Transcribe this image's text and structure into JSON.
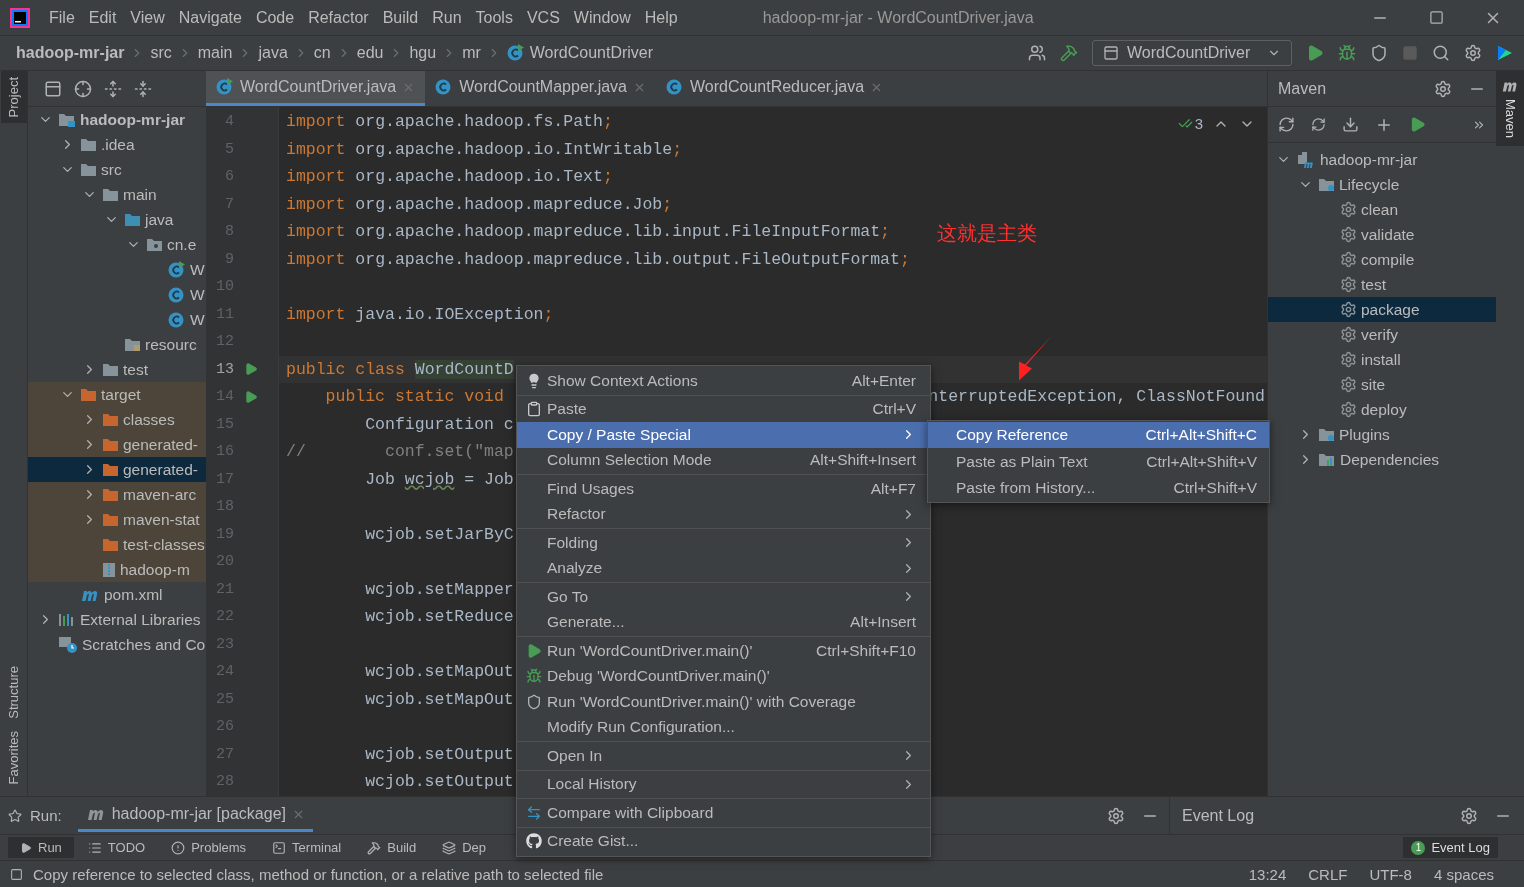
{
  "window": {
    "title": "hadoop-mr-jar - WordCountDriver.java"
  },
  "menu_bar": [
    "File",
    "Edit",
    "View",
    "Navigate",
    "Code",
    "Refactor",
    "Build",
    "Run",
    "Tools",
    "VCS",
    "Window",
    "Help"
  ],
  "breadcrumbs": [
    {
      "label": "hadoop-mr-jar",
      "kind": "project"
    },
    {
      "label": "src",
      "kind": "folder"
    },
    {
      "label": "main",
      "kind": "folder"
    },
    {
      "label": "java",
      "kind": "folder"
    },
    {
      "label": "cn",
      "kind": "folder"
    },
    {
      "label": "edu",
      "kind": "folder"
    },
    {
      "label": "hgu",
      "kind": "folder"
    },
    {
      "label": "mr",
      "kind": "folder"
    },
    {
      "label": "WordCountDriver",
      "kind": "class"
    }
  ],
  "run_config": {
    "label": "WordCountDriver"
  },
  "left_stripe": [
    {
      "label": "Project",
      "selected": true
    },
    {
      "label": "Structure",
      "selected": false
    },
    {
      "label": "Favorites",
      "selected": false
    }
  ],
  "project_tree": [
    {
      "label": "hadoop-mr-jar",
      "kind": "module",
      "expanded": true,
      "selected": false,
      "children": [
        {
          "label": ".idea",
          "kind": "folder",
          "expanded": false,
          "selected": false
        },
        {
          "label": "src",
          "kind": "folder",
          "expanded": true,
          "selected": false,
          "children": [
            {
              "label": "main",
              "kind": "folder",
              "expanded": true,
              "selected": false,
              "children": [
                {
                  "label": "java",
                  "kind": "source",
                  "expanded": true,
                  "selected": false,
                  "children": [
                    {
                      "label": "cn.e",
                      "kind": "package",
                      "expanded": true,
                      "selected": false,
                      "children": [
                        {
                          "label": "W",
                          "kind": "runnable",
                          "selected": false
                        },
                        {
                          "label": "W",
                          "kind": "class",
                          "selected": false
                        },
                        {
                          "label": "W",
                          "kind": "class",
                          "selected": false
                        }
                      ]
                    }
                  ]
                },
                {
                  "label": "resourc",
                  "kind": "resources",
                  "selected": false
                }
              ]
            },
            {
              "label": "test",
              "kind": "folder",
              "expanded": false,
              "selected": false
            }
          ]
        },
        {
          "label": "target",
          "kind": "excluded",
          "expanded": true,
          "selected": false,
          "excluded": true,
          "children": [
            {
              "label": "classes",
              "kind": "excluded",
              "expanded": false,
              "selected": false
            },
            {
              "label": "generated-",
              "kind": "excluded",
              "expanded": false,
              "selected": false
            },
            {
              "label": "generated-",
              "kind": "excluded",
              "expanded": false,
              "selected": true
            },
            {
              "label": "maven-arc",
              "kind": "excluded",
              "expanded": false,
              "selected": false
            },
            {
              "label": "maven-stat",
              "kind": "excluded",
              "expanded": false,
              "selected": false
            },
            {
              "label": "test-classes",
              "kind": "excluded",
              "selected": false
            },
            {
              "label": "hadoop-m",
              "kind": "jar",
              "selected": false
            }
          ]
        },
        {
          "label": "pom.xml",
          "kind": "maven",
          "selected": false
        }
      ]
    },
    {
      "label": "External Libraries",
      "kind": "libraries",
      "expanded": false,
      "selected": false
    },
    {
      "label": "Scratches and Co",
      "kind": "scratches",
      "selected": false
    }
  ],
  "editor_tabs": [
    {
      "label": "WordCountDriver.java",
      "selected": true,
      "runnable": true
    },
    {
      "label": "WordCountMapper.java",
      "selected": false,
      "runnable": false
    },
    {
      "label": "WordCountReducer.java",
      "selected": false,
      "runnable": false
    }
  ],
  "inspection": {
    "count": "3"
  },
  "code_lines": [
    {
      "number": "4",
      "current": false,
      "run": false,
      "segments": [
        {
          "kind": "keyword",
          "text": "import"
        },
        {
          "kind": "plain",
          "text": " org.apache.hadoop.fs.Path"
        },
        {
          "kind": "punct",
          "text": ";"
        }
      ]
    },
    {
      "number": "5",
      "current": false,
      "run": false,
      "segments": [
        {
          "kind": "keyword",
          "text": "import"
        },
        {
          "kind": "plain",
          "text": " org.apache.hadoop.io.IntWritable"
        },
        {
          "kind": "punct",
          "text": ";"
        }
      ]
    },
    {
      "number": "6",
      "current": false,
      "run": false,
      "segments": [
        {
          "kind": "keyword",
          "text": "import"
        },
        {
          "kind": "plain",
          "text": " org.apache.hadoop.io.Text"
        },
        {
          "kind": "punct",
          "text": ";"
        }
      ]
    },
    {
      "number": "7",
      "current": false,
      "run": false,
      "segments": [
        {
          "kind": "keyword",
          "text": "import"
        },
        {
          "kind": "plain",
          "text": " org.apache.hadoop.mapreduce.Job"
        },
        {
          "kind": "punct",
          "text": ";"
        }
      ]
    },
    {
      "number": "8",
      "current": false,
      "run": false,
      "segments": [
        {
          "kind": "keyword",
          "text": "import"
        },
        {
          "kind": "plain",
          "text": " org.apache.hadoop.mapreduce.lib.input.FileInputFormat"
        },
        {
          "kind": "punct",
          "text": ";"
        }
      ]
    },
    {
      "number": "9",
      "current": false,
      "run": false,
      "segments": [
        {
          "kind": "keyword",
          "text": "import"
        },
        {
          "kind": "plain",
          "text": " org.apache.hadoop.mapreduce.lib.output.FileOutputFormat"
        },
        {
          "kind": "punct",
          "text": ";"
        }
      ]
    },
    {
      "number": "10",
      "current": false,
      "run": false
    },
    {
      "number": "11",
      "current": false,
      "run": false,
      "segments": [
        {
          "kind": "keyword",
          "text": "import"
        },
        {
          "kind": "plain",
          "text": " java.io.IOException"
        },
        {
          "kind": "punct",
          "text": ";"
        }
      ]
    },
    {
      "number": "12",
      "current": false,
      "run": false
    },
    {
      "number": "13",
      "current": true,
      "run": true,
      "segments": [
        {
          "kind": "keyword",
          "text": "public class "
        },
        {
          "kind": "highlight",
          "text": "WordCountD"
        }
      ]
    },
    {
      "number": "14",
      "current": false,
      "run": true,
      "segments": [
        {
          "kind": "keyword",
          "text": "    public static void"
        }
      ],
      "tail": "nterruptedException, ClassNotFound"
    },
    {
      "number": "15",
      "current": false,
      "run": false,
      "segments": [
        {
          "kind": "plain",
          "text": "        Configuration c"
        }
      ]
    },
    {
      "number": "16",
      "current": false,
      "run": false,
      "segments": [
        {
          "kind": "comment",
          "text": "//        conf.set(\"map"
        }
      ]
    },
    {
      "number": "17",
      "current": false,
      "run": false,
      "segments": [
        {
          "kind": "plain",
          "text": "        Job "
        },
        {
          "kind": "warn",
          "text": "wcjob"
        },
        {
          "kind": "plain",
          "text": " = Job"
        }
      ]
    },
    {
      "number": "18",
      "current": false,
      "run": false
    },
    {
      "number": "19",
      "current": false,
      "run": false,
      "segments": [
        {
          "kind": "plain",
          "text": "        wcjob.setJarByC"
        }
      ]
    },
    {
      "number": "20",
      "current": false,
      "run": false
    },
    {
      "number": "21",
      "current": false,
      "run": false,
      "segments": [
        {
          "kind": "plain",
          "text": "        wcjob.setMapper"
        }
      ]
    },
    {
      "number": "22",
      "current": false,
      "run": false,
      "segments": [
        {
          "kind": "plain",
          "text": "        wcjob.setReduce"
        }
      ]
    },
    {
      "number": "23",
      "current": false,
      "run": false
    },
    {
      "number": "24",
      "current": false,
      "run": false,
      "segments": [
        {
          "kind": "plain",
          "text": "        wcjob.setMapOut"
        }
      ]
    },
    {
      "number": "25",
      "current": false,
      "run": false,
      "segments": [
        {
          "kind": "plain",
          "text": "        wcjob.setMapOut"
        }
      ]
    },
    {
      "number": "26",
      "current": false,
      "run": false
    },
    {
      "number": "27",
      "current": false,
      "run": false,
      "segments": [
        {
          "kind": "plain",
          "text": "        wcjob.setOutput"
        }
      ]
    },
    {
      "number": "28",
      "current": false,
      "run": false,
      "segments": [
        {
          "kind": "plain",
          "text": "        wcjob.setOutput"
        }
      ]
    }
  ],
  "annotation": {
    "text": "这就是主类"
  },
  "context_menu": [
    [
      {
        "label": "Show Context Actions",
        "shortcut": "Alt+Enter",
        "kind": "bulb",
        "selected": false
      }
    ],
    [
      {
        "label": "Paste",
        "shortcut": "Ctrl+V",
        "kind": "paste",
        "selected": false
      },
      {
        "label": "Copy / Paste Special",
        "submenu": true,
        "selected": true
      },
      {
        "label": "Column Selection Mode",
        "shortcut": "Alt+Shift+Insert",
        "selected": false
      }
    ],
    [
      {
        "label": "Find Usages",
        "shortcut": "Alt+F7",
        "selected": false
      },
      {
        "label": "Refactor",
        "submenu": true,
        "selected": false
      }
    ],
    [
      {
        "label": "Folding",
        "submenu": true,
        "selected": false
      },
      {
        "label": "Analyze",
        "submenu": true,
        "selected": false
      }
    ],
    [
      {
        "label": "Go To",
        "submenu": true,
        "selected": false
      },
      {
        "label": "Generate...",
        "shortcut": "Alt+Insert",
        "selected": false
      }
    ],
    [
      {
        "label": "Run 'WordCountDriver.main()'",
        "shortcut": "Ctrl+Shift+F10",
        "kind": "run",
        "selected": false
      },
      {
        "label": "Debug 'WordCountDriver.main()'",
        "kind": "debug",
        "selected": false
      },
      {
        "label": "Run 'WordCountDriver.main()' with Coverage",
        "kind": "coverage",
        "selected": false
      },
      {
        "label": "Modify Run Configuration...",
        "selected": false
      }
    ],
    [
      {
        "label": "Open In",
        "submenu": true,
        "selected": false
      }
    ],
    [
      {
        "label": "Local History",
        "submenu": true,
        "selected": false
      }
    ],
    [
      {
        "label": "Compare with Clipboard",
        "kind": "compare",
        "selected": false
      }
    ],
    [
      {
        "label": "Create Gist...",
        "kind": "github",
        "selected": false
      }
    ]
  ],
  "submenu": [
    {
      "label": "Copy Reference",
      "shortcut": "Ctrl+Alt+Shift+C",
      "selected": true
    },
    {
      "label": "Paste as Plain Text",
      "shortcut": "Ctrl+Alt+Shift+V",
      "selected": false
    },
    {
      "label": "Paste from History...",
      "shortcut": "Ctrl+Shift+V",
      "selected": false
    }
  ],
  "maven": {
    "title": "Maven",
    "tree": [
      {
        "label": "hadoop-mr-jar",
        "kind": "maven-module",
        "expanded": true,
        "selected": false,
        "children": [
          {
            "label": "Lifecycle",
            "kind": "lifecycle",
            "expanded": true,
            "selected": false,
            "children": [
              {
                "label": "clean",
                "kind": "goal",
                "selected": false
              },
              {
                "label": "validate",
                "kind": "goal",
                "selected": false
              },
              {
                "label": "compile",
                "kind": "goal",
                "selected": false
              },
              {
                "label": "test",
                "kind": "goal",
                "selected": false
              },
              {
                "label": "package",
                "kind": "goal",
                "selected": true
              },
              {
                "label": "verify",
                "kind": "goal",
                "selected": false
              },
              {
                "label": "install",
                "kind": "goal",
                "selected": false
              },
              {
                "label": "site",
                "kind": "goal",
                "selected": false
              },
              {
                "label": "deploy",
                "kind": "goal",
                "selected": false
              }
            ]
          },
          {
            "label": "Plugins",
            "kind": "lifecycle",
            "expanded": false,
            "selected": false
          },
          {
            "label": "Dependencies",
            "kind": "dependencies",
            "expanded": false,
            "selected": false
          }
        ]
      }
    ]
  },
  "right_stripe": {
    "label": "Maven"
  },
  "run_panel": {
    "label": "Run:",
    "tab": "hadoop-mr-jar [package]"
  },
  "event_log": {
    "title": "Event Log"
  },
  "tool_tabs": [
    {
      "label": "Run",
      "kind": "run",
      "selected": true
    },
    {
      "label": "TODO",
      "kind": "list",
      "selected": false
    },
    {
      "label": "Problems",
      "kind": "problems",
      "selected": false
    },
    {
      "label": "Terminal",
      "kind": "terminal",
      "selected": false
    },
    {
      "label": "Build",
      "kind": "build",
      "selected": false
    },
    {
      "label": "Dep",
      "kind": "layers",
      "selected": false
    }
  ],
  "event_log_button": {
    "label": "Event Log",
    "badge": "1"
  },
  "status_bar": {
    "message": "Copy reference to selected class, method or function, or a relative path to selected file",
    "items": [
      "13:24",
      "CRLF",
      "UTF-8",
      "4 spaces"
    ]
  }
}
